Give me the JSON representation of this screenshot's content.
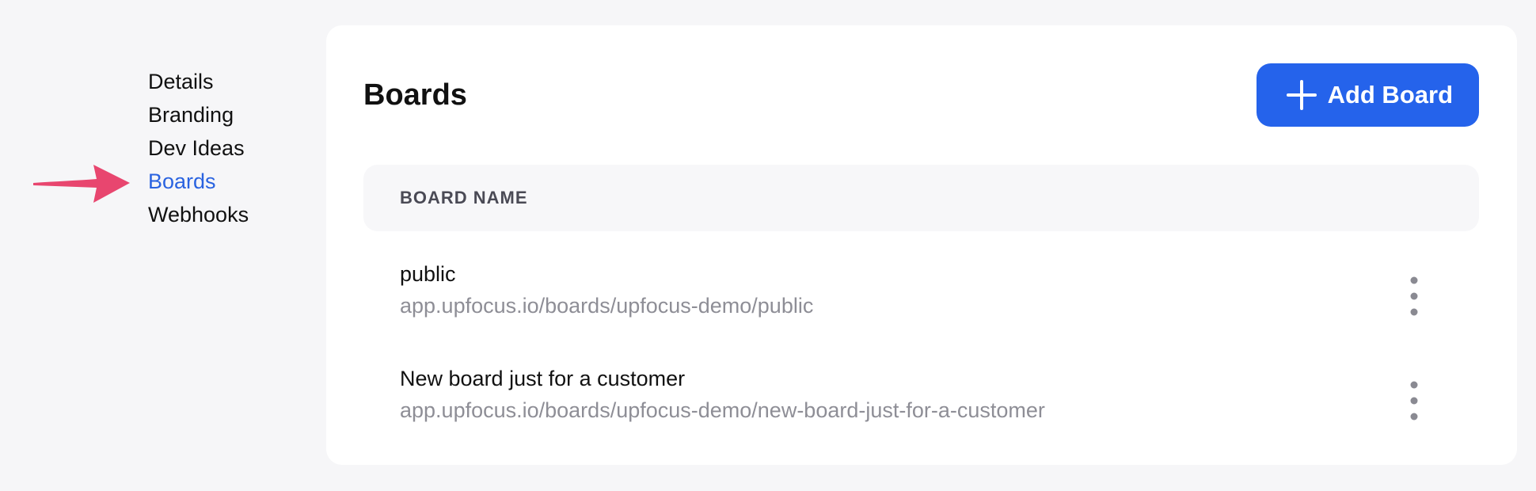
{
  "sidebar": {
    "items": [
      {
        "label": "Details",
        "active": false
      },
      {
        "label": "Branding",
        "active": false
      },
      {
        "label": "Dev Ideas",
        "active": false
      },
      {
        "label": "Boards",
        "active": true
      },
      {
        "label": "Webhooks",
        "active": false
      }
    ]
  },
  "colors": {
    "accent": "#2563eb",
    "active_nav": "#2a63e0",
    "pointer_arrow": "#e8466f",
    "muted_text": "#8e8e96"
  },
  "main": {
    "title": "Boards",
    "add_button": {
      "label": "Add Board",
      "icon": "plus-icon"
    },
    "table": {
      "columns": [
        "BOARD NAME"
      ],
      "rows": [
        {
          "name": "public",
          "url": "app.upfocus.io/boards/upfocus-demo/public",
          "action_icon": "more-vertical-icon"
        },
        {
          "name": "New board just for a customer",
          "url": "app.upfocus.io/boards/upfocus-demo/new-board-just-for-a-customer",
          "action_icon": "more-vertical-icon"
        }
      ]
    }
  },
  "annotation": {
    "icon": "pointer-arrow-icon"
  }
}
